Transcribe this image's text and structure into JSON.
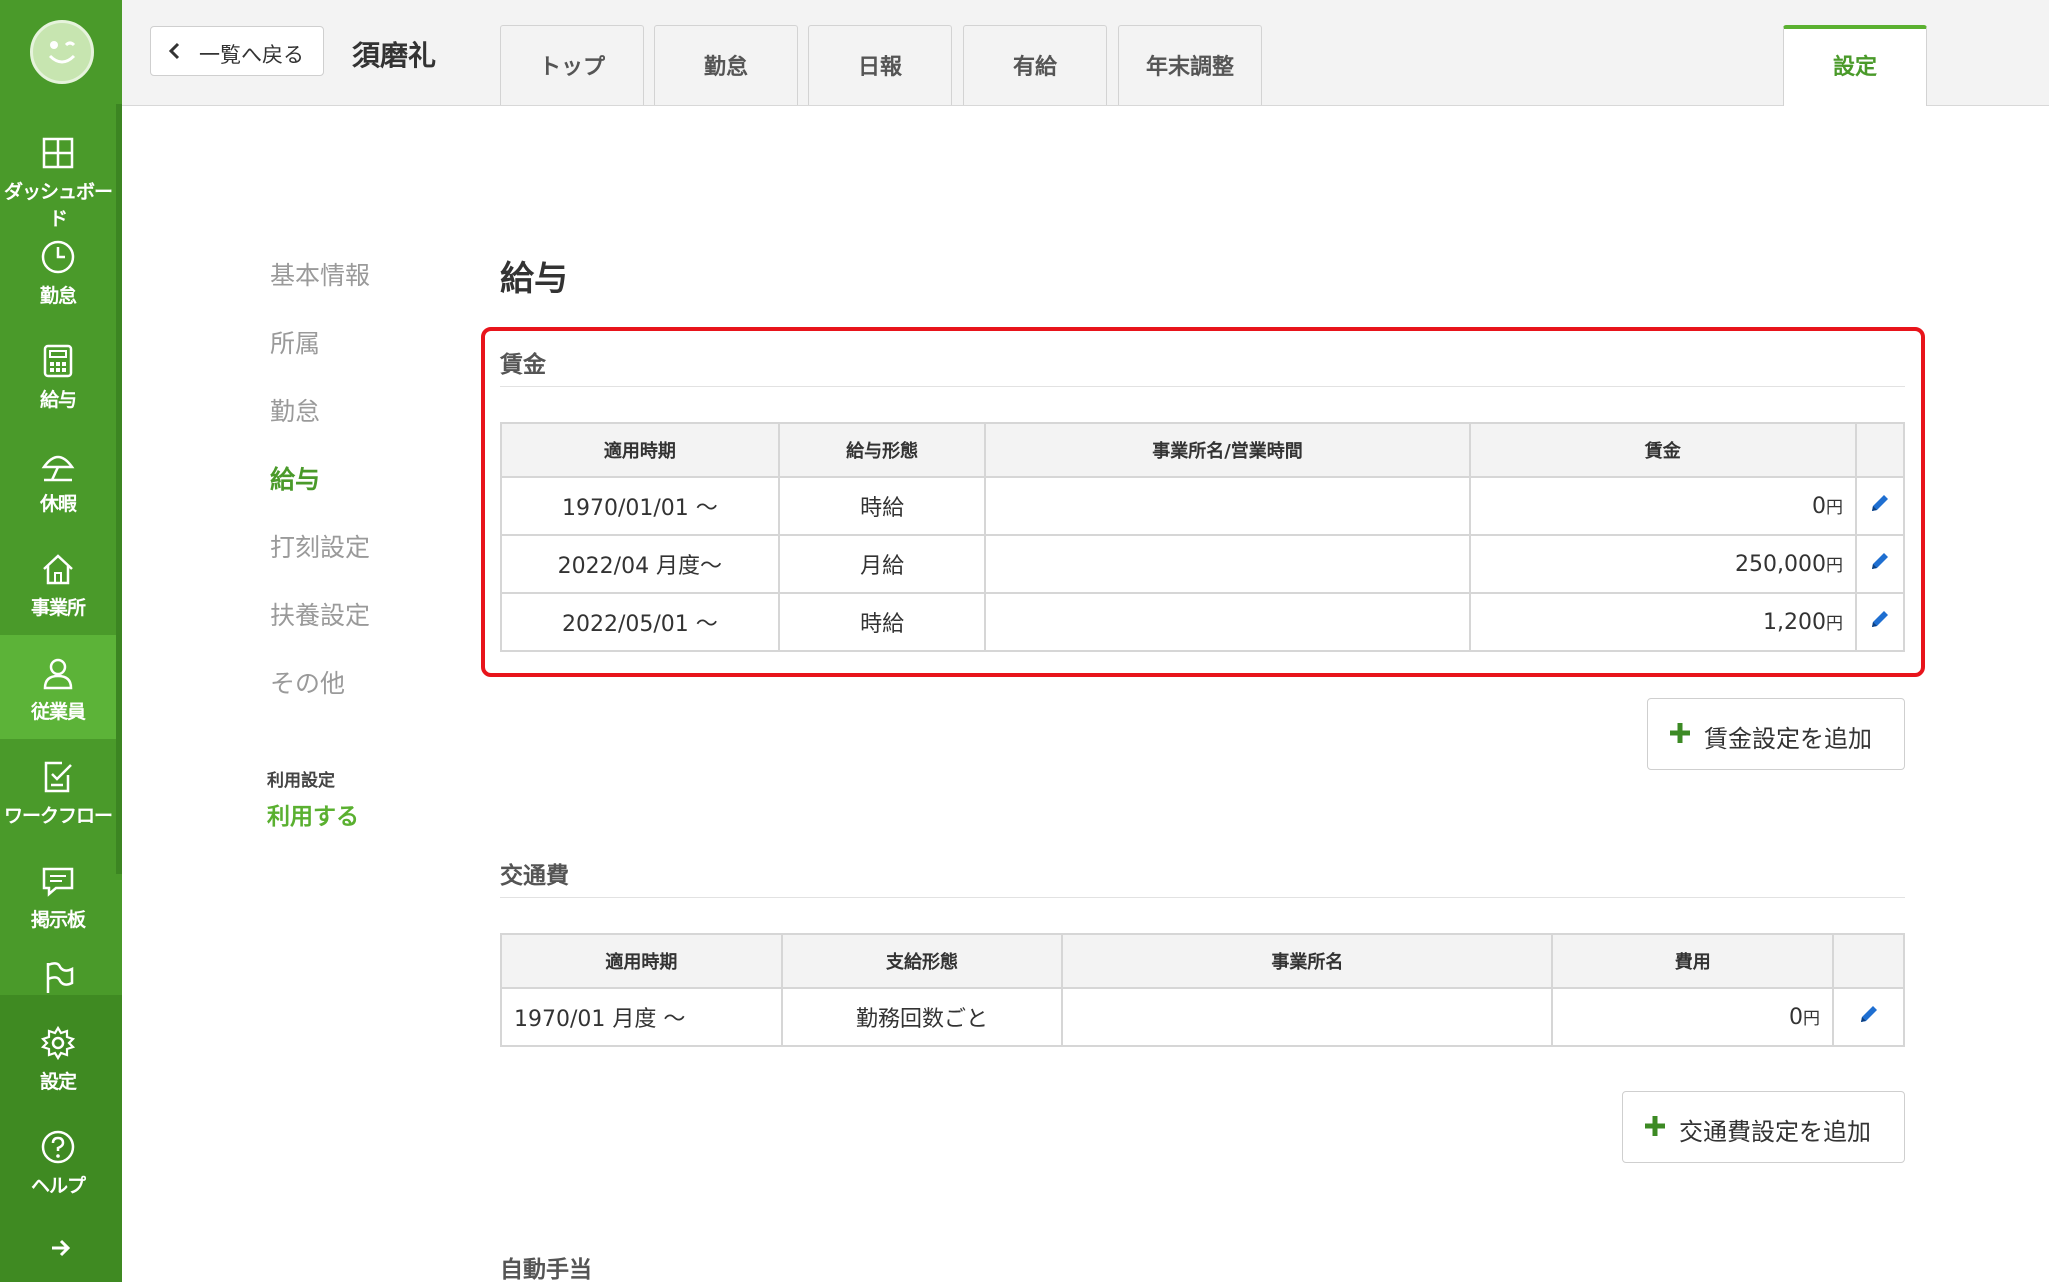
{
  "sidebar": {
    "items": [
      {
        "label": "ダッシュボード",
        "icon": "dashboard-icon"
      },
      {
        "label": "勤怠",
        "icon": "clock-icon"
      },
      {
        "label": "給与",
        "icon": "calculator-icon"
      },
      {
        "label": "休暇",
        "icon": "umbrella-icon"
      },
      {
        "label": "事業所",
        "icon": "home-icon"
      },
      {
        "label": "従業員",
        "icon": "person-icon",
        "active": true
      },
      {
        "label": "ワークフロー",
        "icon": "workflow-icon"
      },
      {
        "label": "掲示板",
        "icon": "message-icon"
      },
      {
        "label": "",
        "icon": "flag-icon"
      },
      {
        "label": "設定",
        "icon": "gear-icon"
      },
      {
        "label": "ヘルプ",
        "icon": "help-icon"
      }
    ],
    "expand_icon": "arrow-right-icon"
  },
  "header": {
    "back_label": "一覧へ戻る",
    "employee_name": "須磨礼",
    "tabs": [
      "トップ",
      "勤怠",
      "日報",
      "有給",
      "年末調整"
    ],
    "settings_tab": "設定"
  },
  "subnav": {
    "items": [
      "基本情報",
      "所属",
      "勤怠",
      "給与",
      "打刻設定",
      "扶養設定",
      "その他"
    ],
    "current": "給与",
    "use_label": "利用設定",
    "use_value": "利用する"
  },
  "main": {
    "title": "給与",
    "wage": {
      "title": "賃金",
      "headers": [
        "適用時期",
        "給与形態",
        "事業所名/営業時間",
        "賃金"
      ],
      "rows": [
        {
          "period": "1970/01/01 〜",
          "type": "時給",
          "office": "",
          "amount": "0",
          "unit": "円"
        },
        {
          "period": "2022/04 月度〜",
          "type": "月給",
          "office": "",
          "amount": "250,000",
          "unit": "円"
        },
        {
          "period": "2022/05/01 〜",
          "type": "時給",
          "office": "",
          "amount": "1,200",
          "unit": "円"
        }
      ],
      "add_label": "賃金設定を追加"
    },
    "transport": {
      "title": "交通費",
      "headers": [
        "適用時期",
        "支給形態",
        "事業所名",
        "費用"
      ],
      "rows": [
        {
          "period": "1970/01 月度 〜",
          "type": "勤務回数ごと",
          "office": "",
          "amount": "0",
          "unit": "円"
        }
      ],
      "add_label": "交通費設定を追加"
    },
    "allowance": {
      "title": "自動手当"
    }
  },
  "colors": {
    "brand_green": "#4a9a2a",
    "accent_green": "#5ab030",
    "highlight_red": "#e8141b",
    "edit_blue": "#1f6fd1"
  }
}
